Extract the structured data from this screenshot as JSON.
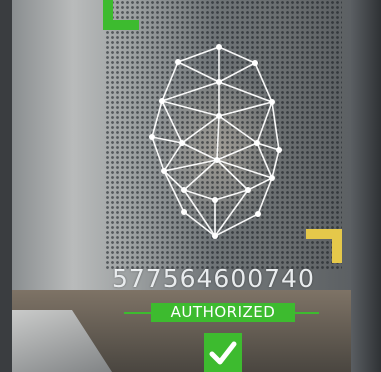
{
  "id_number": "577564600740",
  "status_label": "AUTHORIZED",
  "icons": {
    "top_left_corner": "corner-bracket-icon",
    "bottom_right_corner": "corner-bracket-icon",
    "checkmark": "checkmark-icon"
  },
  "colors": {
    "authorized_green": "#3dbb2f",
    "corner_yellow": "#e5c84a",
    "mesh_white": "#ffffff"
  }
}
